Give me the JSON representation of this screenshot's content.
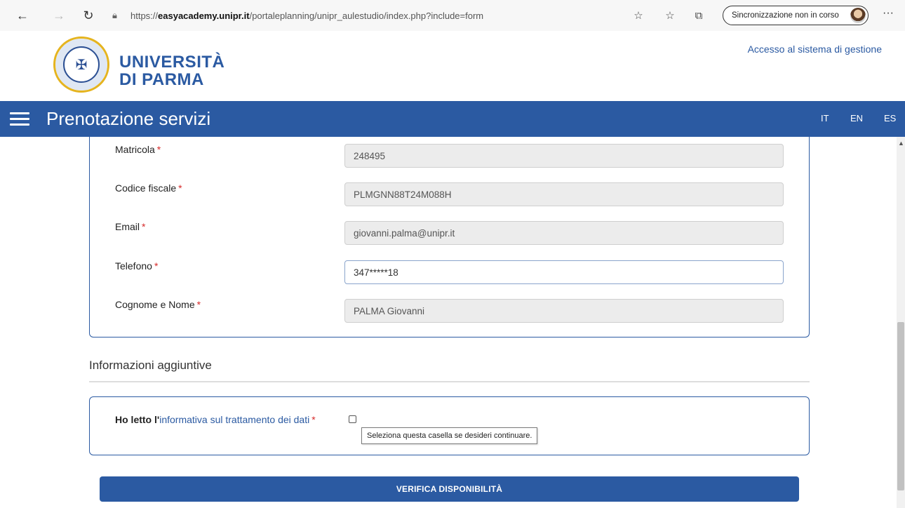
{
  "browser": {
    "url_prefix": "https://",
    "url_host": "easyacademy.unipr.it",
    "url_path": "/portaleplanning/unipr_aulestudio/index.php?include=form",
    "sync_label": "Sincronizzazione non in corso"
  },
  "header": {
    "university_line1": "UNIVERSITÀ",
    "university_line2": "DI PARMA",
    "access_link": "Accesso al sistema di gestione"
  },
  "navbar": {
    "title": "Prenotazione servizi",
    "languages": [
      "IT",
      "EN",
      "ES"
    ]
  },
  "form": {
    "fields": [
      {
        "label": "Matricola",
        "value": "248495"
      },
      {
        "label": "Codice fiscale",
        "value": "PLMGNN88T24M088H"
      },
      {
        "label": "Email",
        "value": "giovanni.palma@unipr.it"
      },
      {
        "label": "Telefono",
        "value": "347*****18"
      },
      {
        "label": "Cognome e Nome",
        "value": "PALMA Giovanni"
      }
    ],
    "required_mark": "*"
  },
  "additional": {
    "section_title": "Informazioni aggiuntive",
    "consent_prefix": "Ho letto l'",
    "consent_link": "informativa sul trattamento dei dati",
    "tooltip": "Seleziona questa casella se desideri continuare."
  },
  "actions": {
    "verify_button": "VERIFICA DISPONIBILITÀ"
  },
  "colors": {
    "brand_blue": "#2b5aa2",
    "required_red": "#d62a2a"
  }
}
